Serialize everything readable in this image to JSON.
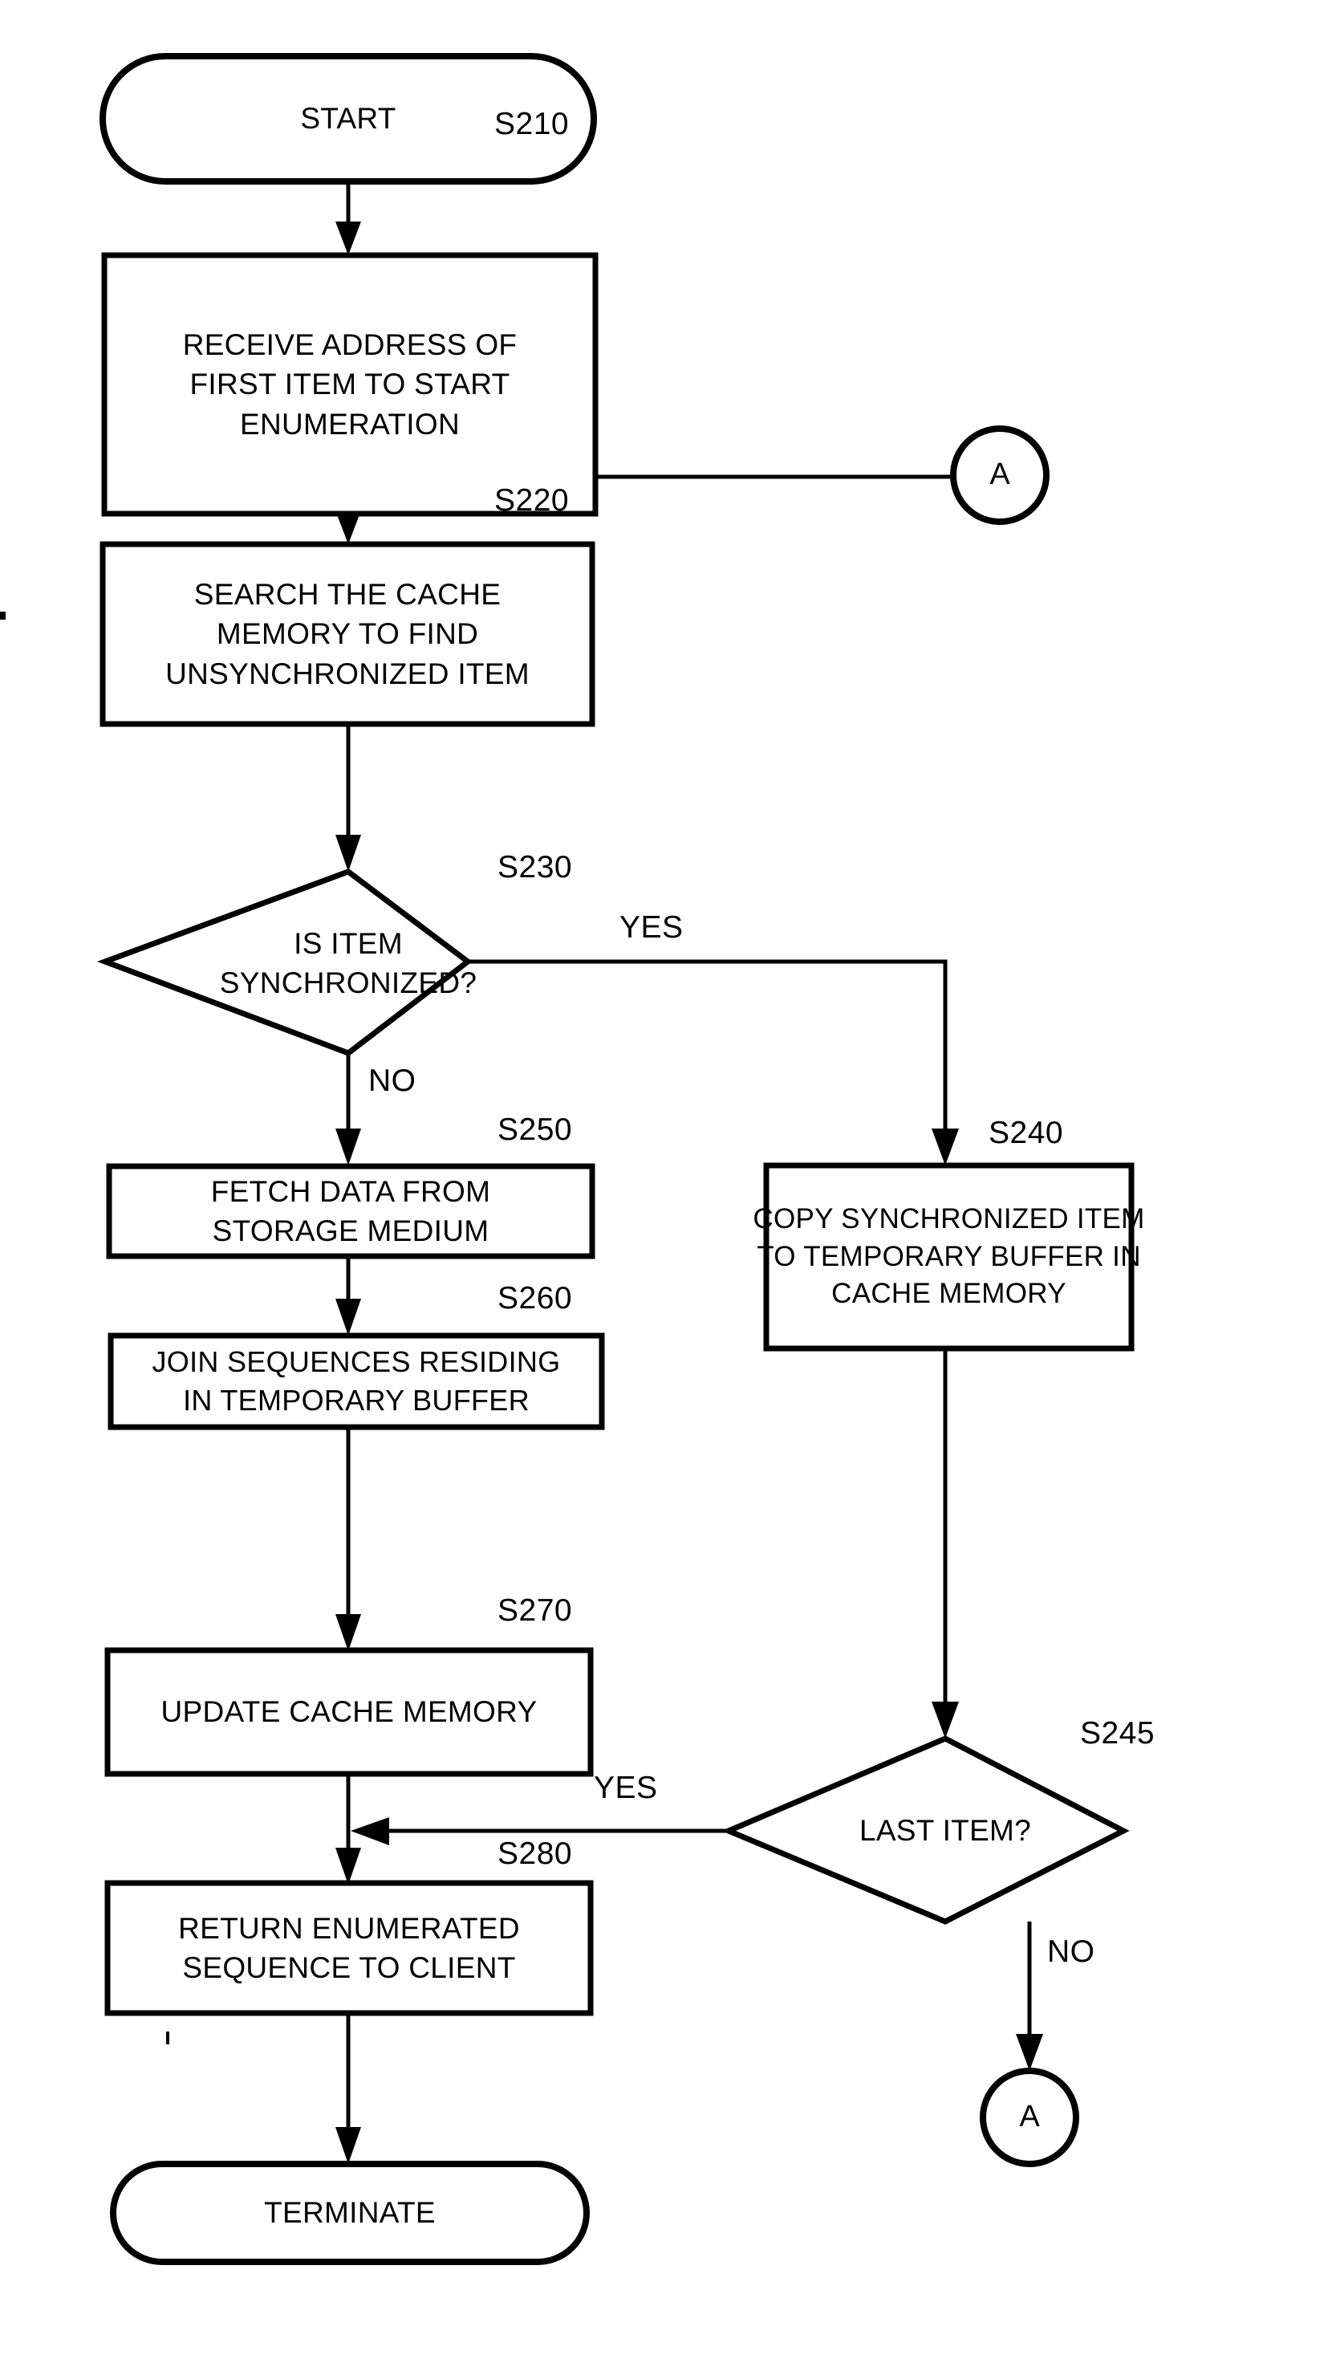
{
  "diagram": {
    "type": "flowchart",
    "orientation": "vertical",
    "line_color": "#000000",
    "fill_color": "#ffffff"
  },
  "nodes": {
    "start": {
      "label": "START",
      "shape": "terminator"
    },
    "s210": {
      "label_lines": [
        "RECEIVE ADDRESS OF",
        "FIRST ITEM TO START",
        "ENUMERATION"
      ],
      "tag": "S210",
      "shape": "process"
    },
    "s220": {
      "label_lines": [
        "SEARCH THE CACHE",
        "MEMORY TO FIND",
        "UNSYNCHRONIZED ITEM"
      ],
      "tag": "S220",
      "shape": "process"
    },
    "s230": {
      "label_lines": [
        "IS ITEM",
        "SYNCHRONIZED?"
      ],
      "tag": "S230",
      "shape": "decision"
    },
    "s240": {
      "label_lines": [
        "COPY SYNCHRONIZED ITEM",
        "TO TEMPORARY BUFFER IN",
        "CACHE MEMORY"
      ],
      "tag": "S240",
      "shape": "process"
    },
    "s245": {
      "label_lines": [
        "LAST ITEM?"
      ],
      "tag": "S245",
      "shape": "decision"
    },
    "s250": {
      "label_lines": [
        "FETCH DATA FROM",
        "STORAGE MEDIUM"
      ],
      "tag": "S250",
      "shape": "process"
    },
    "s260": {
      "label_lines": [
        "JOIN SEQUENCES RESIDING",
        "IN TEMPORARY BUFFER"
      ],
      "tag": "S260",
      "shape": "process"
    },
    "s270": {
      "label_lines": [
        "UPDATE CACHE MEMORY"
      ],
      "tag": "S270",
      "shape": "process"
    },
    "s280": {
      "label_lines": [
        "RETURN ENUMERATED",
        "SEQUENCE TO CLIENT"
      ],
      "tag": "S280",
      "shape": "process"
    },
    "terminate": {
      "label": "TERMINATE",
      "shape": "terminator"
    },
    "connector_a_top": {
      "label": "A",
      "shape": "off-page-connector"
    },
    "connector_a_bottom": {
      "label": "A",
      "shape": "off-page-connector"
    }
  },
  "edge_labels": {
    "s230_yes": "YES",
    "s230_no": "NO",
    "s245_yes": "YES",
    "s245_no": "NO"
  },
  "edges": [
    {
      "from": "start",
      "to": "s210",
      "label": ""
    },
    {
      "from": "s210",
      "to": "s220",
      "label": ""
    },
    {
      "from": "connector_a_top",
      "to": "s220",
      "label": ""
    },
    {
      "from": "s220",
      "to": "s230",
      "label": ""
    },
    {
      "from": "s230",
      "to": "s240",
      "label": "YES"
    },
    {
      "from": "s230",
      "to": "s250",
      "label": "NO"
    },
    {
      "from": "s240",
      "to": "s245",
      "label": ""
    },
    {
      "from": "s250",
      "to": "s260",
      "label": ""
    },
    {
      "from": "s260",
      "to": "s270",
      "label": ""
    },
    {
      "from": "s270",
      "to": "s280",
      "label": ""
    },
    {
      "from": "s245",
      "to": "s280",
      "label": "YES"
    },
    {
      "from": "s245",
      "to": "connector_a_bottom",
      "label": "NO"
    },
    {
      "from": "s280",
      "to": "terminate",
      "label": ""
    }
  ]
}
